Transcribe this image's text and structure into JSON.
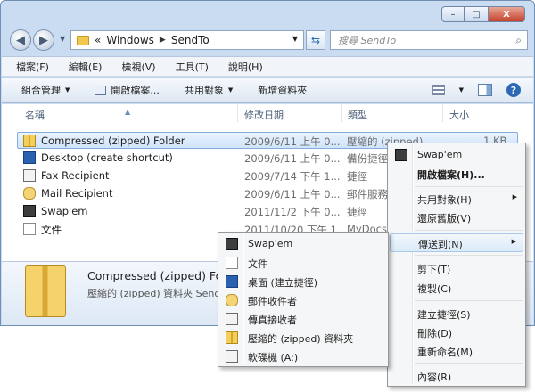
{
  "window": {
    "caption_buttons": {
      "minimize": "–",
      "maximize": "□",
      "close": "X"
    }
  },
  "nav": {
    "back_icon": "back-arrow-icon",
    "forward_icon": "forward-arrow-icon",
    "address_prefix": "«",
    "path": [
      "Windows",
      "SendTo"
    ],
    "separator": "▶",
    "search_placeholder": "搜尋 SendTo"
  },
  "menubar": [
    "檔案(F)",
    "編輯(E)",
    "檢視(V)",
    "工具(T)",
    "說明(H)"
  ],
  "commandbar": {
    "organize": "組合管理",
    "open": "開啟檔案...",
    "share": "共用對象",
    "new_folder": "新增資料夾"
  },
  "columns": {
    "name": "名稱",
    "date": "修改日期",
    "type": "類型",
    "size": "大小"
  },
  "files": [
    {
      "name": "Compressed (zipped) Folder",
      "date": "2009/6/11 上午 0...",
      "type": "壓縮的 (zipped) ...",
      "size": "1 KB",
      "icon": "zip-folder-icon",
      "selected": true
    },
    {
      "name": "Desktop (create shortcut)",
      "date": "2009/6/11 上午 0...",
      "type": "備份捷徑",
      "size": "",
      "icon": "desktop-icon"
    },
    {
      "name": "Fax Recipient",
      "date": "2009/7/14 下午 1...",
      "type": "捷徑",
      "size": "",
      "icon": "fax-icon"
    },
    {
      "name": "Mail Recipient",
      "date": "2009/6/11 上午 0...",
      "type": "郵件服務",
      "size": "",
      "icon": "mail-icon"
    },
    {
      "name": "Swap'em",
      "date": "2011/11/2 下午 0...",
      "type": "捷徑",
      "size": "",
      "icon": "swapem-icon"
    },
    {
      "name": "文件",
      "date": "2011/10/20 下午 1...",
      "type": "MyDocs",
      "size": "",
      "icon": "document-icon"
    }
  ],
  "details": {
    "name": "Compressed (zipped) Folder",
    "type": "壓縮的 (zipped) 資料夾 Send"
  },
  "context_menu": {
    "items": [
      "Swap'em",
      "開啟檔案(H)...",
      "共用對象(H)",
      "還原舊版(V)",
      "傳送到(N)",
      "剪下(T)",
      "複製(C)",
      "建立捷徑(S)",
      "刪除(D)",
      "重新命名(M)",
      "內容(R)"
    ]
  },
  "sendto_menu": {
    "items": [
      "Swap'em",
      "文件",
      "桌面 (建立捷徑)",
      "郵件收件者",
      "傳真接收者",
      "壓縮的 (zipped) 資料夾",
      "軟碟機 (A:)"
    ]
  }
}
